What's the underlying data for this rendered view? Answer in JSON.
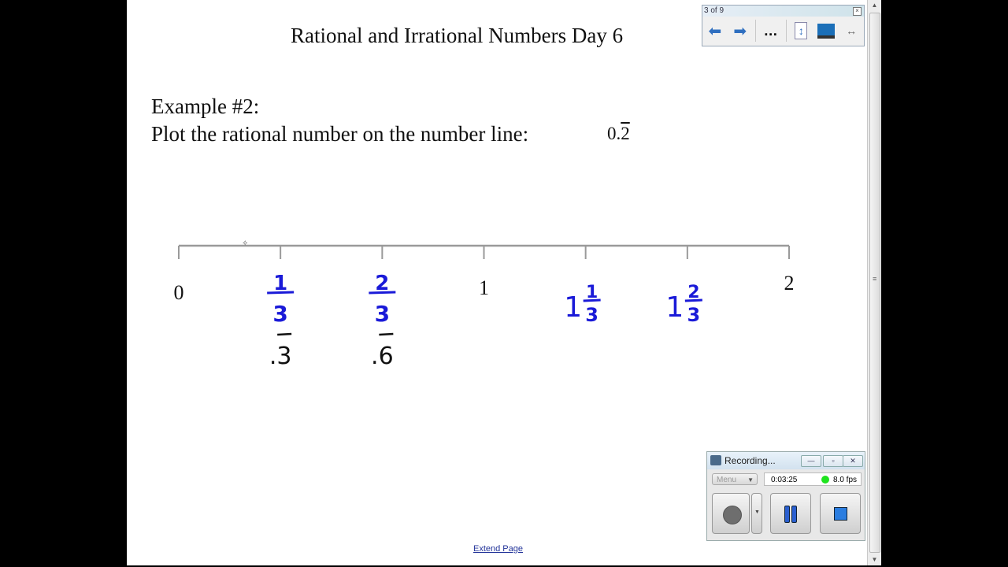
{
  "slide": {
    "title": "Rational and Irrational Numbers Day 6",
    "example_label": "Example #2:",
    "instruction": "Plot the rational number on the number line:",
    "value_prefix": "0.",
    "value_repeating": "2",
    "extend_page_link": "Extend Page"
  },
  "number_line": {
    "range": [
      0,
      2
    ],
    "tick_values": [
      0,
      0.3333,
      0.6667,
      1,
      1.3333,
      1.6667,
      2
    ],
    "printed_labels": [
      {
        "value": 0,
        "text": "0"
      },
      {
        "value": 1,
        "text": "1"
      },
      {
        "value": 2,
        "text": "2"
      }
    ],
    "handwritten_fractions": [
      {
        "value": 0.3333,
        "whole": "",
        "numerator": "1",
        "denominator": "3",
        "decimal": ".3",
        "decimal_repeating": true
      },
      {
        "value": 0.6667,
        "whole": "",
        "numerator": "2",
        "denominator": "3",
        "decimal": ".6",
        "decimal_repeating": true
      },
      {
        "value": 1.3333,
        "whole": "1",
        "numerator": "1",
        "denominator": "3"
      },
      {
        "value": 1.6667,
        "whole": "1",
        "numerator": "2",
        "denominator": "3"
      }
    ],
    "colors": {
      "line": "#9a9a9a",
      "ink_blue": "#1a1ad8",
      "ink_black": "#111111"
    }
  },
  "page_navigator": {
    "page_indicator": "3 of 9",
    "icons": [
      "previous-page-icon",
      "next-page-icon",
      "more-icon",
      "fit-page-icon",
      "display-screen-icon",
      "dual-arrow-icon"
    ]
  },
  "recorder": {
    "title": "Recording...",
    "menu_label": "Menu",
    "elapsed_time": "0:03:25",
    "fps": "8.0 fps",
    "status_color": "#1ee31e"
  }
}
